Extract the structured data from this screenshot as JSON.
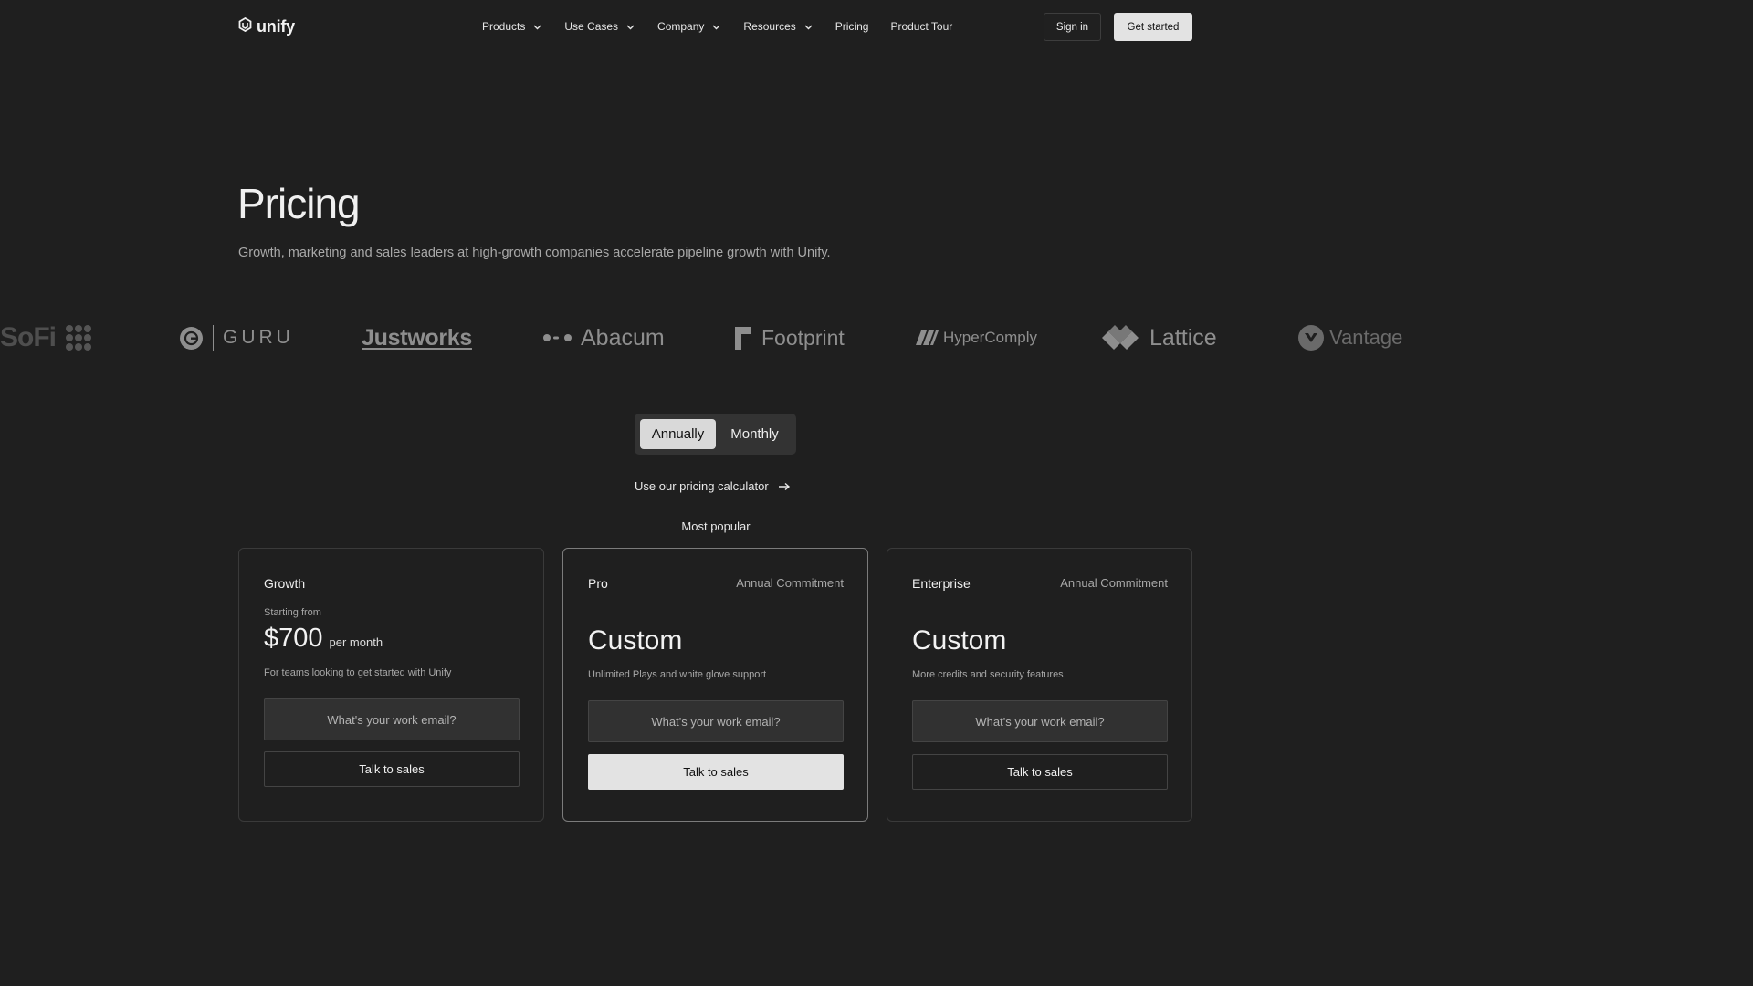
{
  "brand": {
    "name": "unify"
  },
  "nav": {
    "items": [
      {
        "label": "Products",
        "has_dropdown": true
      },
      {
        "label": "Use Cases",
        "has_dropdown": true
      },
      {
        "label": "Company",
        "has_dropdown": true
      },
      {
        "label": "Resources",
        "has_dropdown": true
      },
      {
        "label": "Pricing",
        "has_dropdown": false
      },
      {
        "label": "Product Tour",
        "has_dropdown": false
      }
    ],
    "sign_in": "Sign in",
    "get_started": "Get started"
  },
  "hero": {
    "title": "Pricing",
    "subtitle": "Growth, marketing and sales leaders at high-growth companies accelerate pipeline growth with Unify."
  },
  "logos": {
    "sofi": "SoFi",
    "guru": "GURU",
    "justworks": "Justworks",
    "abacum": "Abacum",
    "footprint": "Footprint",
    "hypercomply": "HyperComply",
    "lattice": "Lattice",
    "vantage": "Vantage"
  },
  "billing_toggle": {
    "options": [
      "Annually",
      "Monthly"
    ],
    "selected": "Annually"
  },
  "calculator_link": "Use our pricing calculator",
  "most_popular": "Most popular",
  "plans": [
    {
      "name": "Growth",
      "starting_from": "Starting from",
      "price": "$700",
      "period": "per month",
      "description": "For teams looking to get started with Unify",
      "email_placeholder": "What's your work email?",
      "cta": "Talk to sales"
    },
    {
      "name": "Pro",
      "commitment": "Annual Commitment",
      "price": "Custom",
      "description": "Unlimited Plays and white glove support",
      "email_placeholder": "What's your work email?",
      "cta": "Talk to sales"
    },
    {
      "name": "Enterprise",
      "commitment": "Annual Commitment",
      "price": "Custom",
      "description": "More credits and security features",
      "email_placeholder": "What's your work email?",
      "cta": "Talk to sales"
    }
  ],
  "colors": {
    "background": "#1f1f1f",
    "primary_button": "#e3e3e3",
    "muted_text": "#a7a7a7"
  }
}
